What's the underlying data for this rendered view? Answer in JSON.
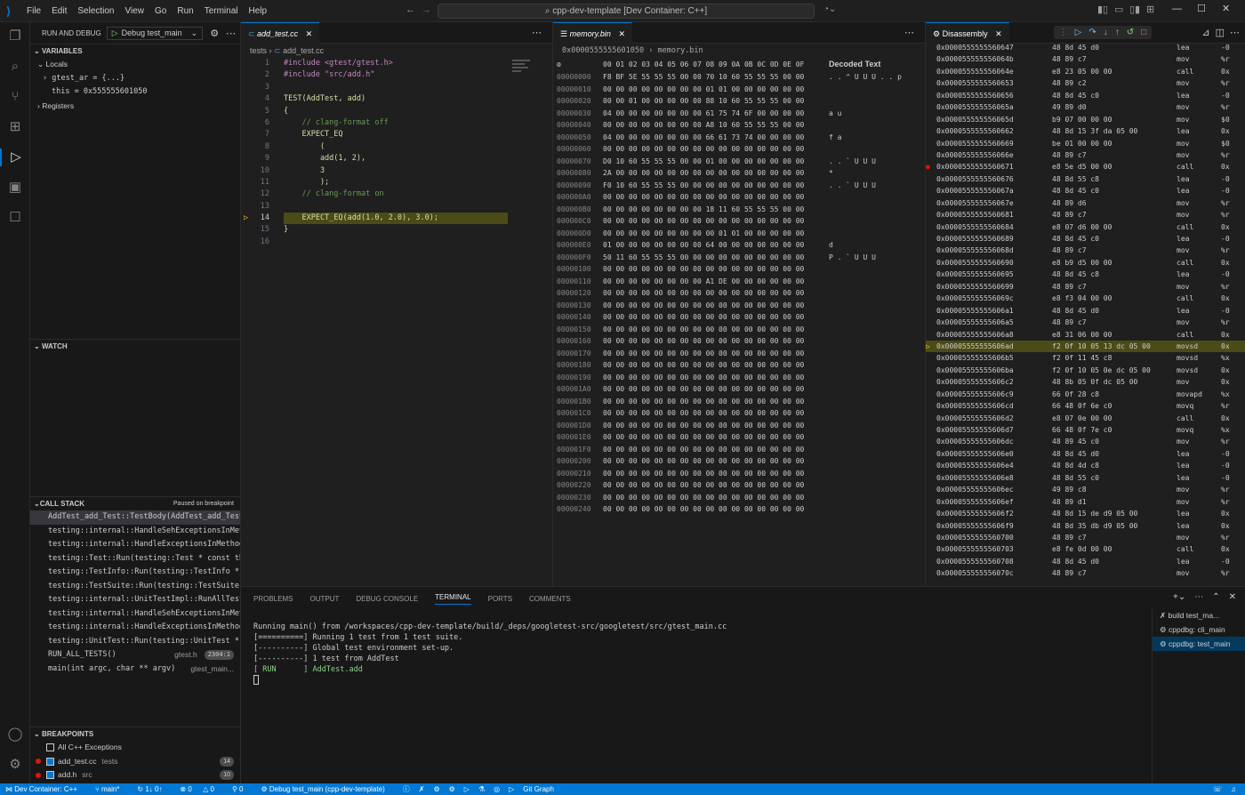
{
  "menu": [
    "File",
    "Edit",
    "Selection",
    "View",
    "Go",
    "Run",
    "Terminal",
    "Help"
  ],
  "command_center": "cpp-dev-template [Dev Container: C++]",
  "sidebar": {
    "title": "RUN AND DEBUG",
    "config": "Debug test_main",
    "variables_header": "VARIABLES",
    "locals": "Locals",
    "vars": [
      "gtest_ar = {...}",
      "this = 0x555555601050"
    ],
    "registers": "Registers",
    "watch_header": "WATCH",
    "callstack_header": "CALL STACK",
    "callstack_status": "Paused on breakpoint",
    "frames": [
      {
        "name": "AddTest_add_Test::TestBody(AddTest_add_Test",
        "file": "",
        "badge": ""
      },
      {
        "name": "testing::internal::HandleSehExceptionsInMet",
        "file": "",
        "badge": ""
      },
      {
        "name": "testing::internal::HandleExceptionsInMethod",
        "file": "",
        "badge": ""
      },
      {
        "name": "testing::Test::Run(testing::Test * const th",
        "file": "",
        "badge": ""
      },
      {
        "name": "testing::TestInfo::Run(testing::TestInfo *",
        "file": "",
        "badge": ""
      },
      {
        "name": "testing::TestSuite::Run(testing::TestSuite",
        "file": "",
        "badge": ""
      },
      {
        "name": "testing::internal::UnitTestImpl::RunAllTest",
        "file": "",
        "badge": ""
      },
      {
        "name": "testing::internal::HandleSehExceptionsInMet",
        "file": "",
        "badge": ""
      },
      {
        "name": "testing::internal::HandleExceptionsInMethod",
        "file": "",
        "badge": ""
      },
      {
        "name": "testing::UnitTest::Run(testing::UnitTest *",
        "file": "",
        "badge": ""
      },
      {
        "name": "RUN_ALL_TESTS()",
        "file": "gtest.h",
        "badge": "2304:1"
      },
      {
        "name": "main(int argc, char ** argv)",
        "file": "gtest_main...",
        "badge": ""
      }
    ],
    "breakpoints_header": "BREAKPOINTS",
    "breakpoints": [
      {
        "label": "All C++ Exceptions",
        "dir": "",
        "count": ""
      },
      {
        "label": "add_test.cc",
        "dir": "tests",
        "count": "14"
      },
      {
        "label": "add.h",
        "dir": "src",
        "count": "10"
      }
    ]
  },
  "editor1": {
    "tab": "add_test.cc",
    "crumb_dir": "tests",
    "crumb_file": "add_test.cc",
    "lines": [
      "#include <gtest/gtest.h>",
      "#include \"src/add.h\"",
      "",
      "TEST(AddTest, add)",
      "{",
      "    // clang-format off",
      "    EXPECT_EQ",
      "        (",
      "        add(1, 2),",
      "        3",
      "        );",
      "    // clang-format on",
      "",
      "    EXPECT_EQ(add(1.0, 2.0), 3.0);",
      "}",
      ""
    ],
    "current_line": 14
  },
  "editor2": {
    "tab": "memory.bin",
    "crumb_addr": "0x0000555555601050",
    "crumb_file": "memory.bin",
    "header": "00 01 02 03 04 05 06 07 08 09 0A 0B 0C 0D 0E 0F",
    "decoded_title": "Decoded Text",
    "rows": [
      {
        "o": "00000000",
        "h": "F8 BF 5E 55 55 55 00 00 70 10 60 55 55 55 00 00",
        "d": ". . ^ U U U . . p"
      },
      {
        "o": "00000010",
        "h": "00 00 00 00 00 00 00 00 01 01 00 00 00 00 00 00",
        "d": ""
      },
      {
        "o": "00000020",
        "h": "00 00 01 00 00 00 00 00 88 10 60 55 55 55 00 00",
        "d": ""
      },
      {
        "o": "00000030",
        "h": "04 00 00 00 00 00 00 00 61 75 74 6F 00 00 00 00",
        "d": "a u"
      },
      {
        "o": "00000040",
        "h": "00 00 00 00 00 00 00 00 A8 10 60 55 55 55 00 00",
        "d": ""
      },
      {
        "o": "00000050",
        "h": "04 00 00 00 00 00 00 00 66 61 73 74 00 00 00 00",
        "d": "f a"
      },
      {
        "o": "00000060",
        "h": "00 00 00 00 00 00 00 00 00 00 00 00 00 00 00 00",
        "d": ""
      },
      {
        "o": "00000070",
        "h": "D0 10 60 55 55 55 00 00 01 00 00 00 00 00 00 00",
        "d": ". . ` U U U"
      },
      {
        "o": "00000080",
        "h": "2A 00 00 00 00 00 00 00 00 00 00 00 00 00 00 00",
        "d": "*"
      },
      {
        "o": "00000090",
        "h": "F0 10 60 55 55 55 00 00 00 00 00 00 00 00 00 00",
        "d": ". . ` U U U"
      },
      {
        "o": "000000A0",
        "h": "00 00 00 00 00 00 00 00 00 00 00 00 00 00 00 00",
        "d": ""
      },
      {
        "o": "000000B0",
        "h": "00 00 00 00 00 00 00 00 18 11 60 55 55 55 00 00",
        "d": ""
      },
      {
        "o": "000000C0",
        "h": "00 00 00 00 00 00 00 00 00 00 00 00 00 00 00 00",
        "d": ""
      },
      {
        "o": "000000D0",
        "h": "00 00 00 00 00 00 00 00 00 01 01 00 00 00 00 00",
        "d": ""
      },
      {
        "o": "000000E0",
        "h": "01 00 00 00 00 00 00 00 64 00 00 00 00 00 00 00",
        "d": "d"
      },
      {
        "o": "000000F0",
        "h": "50 11 60 55 55 55 00 00 00 00 00 00 00 00 00 00",
        "d": "P . ` U U U"
      },
      {
        "o": "00000100",
        "h": "00 00 00 00 00 00 00 00 00 00 00 00 00 00 00 00",
        "d": ""
      },
      {
        "o": "00000110",
        "h": "00 00 00 00 00 00 00 00 A1 DE 00 00 00 00 00 00",
        "d": ""
      },
      {
        "o": "00000120",
        "h": "00 00 00 00 00 00 00 00 00 00 00 00 00 00 00 00",
        "d": ""
      },
      {
        "o": "00000130",
        "h": "00 00 00 00 00 00 00 00 00 00 00 00 00 00 00 00",
        "d": ""
      },
      {
        "o": "00000140",
        "h": "00 00 00 00 00 00 00 00 00 00 00 00 00 00 00 00",
        "d": ""
      },
      {
        "o": "00000150",
        "h": "00 00 00 00 00 00 00 00 00 00 00 00 00 00 00 00",
        "d": ""
      },
      {
        "o": "00000160",
        "h": "00 00 00 00 00 00 00 00 00 00 00 00 00 00 00 00",
        "d": ""
      },
      {
        "o": "00000170",
        "h": "00 00 00 00 00 00 00 00 00 00 00 00 00 00 00 00",
        "d": ""
      },
      {
        "o": "00000180",
        "h": "00 00 00 00 00 00 00 00 00 00 00 00 00 00 00 00",
        "d": ""
      },
      {
        "o": "00000190",
        "h": "00 00 00 00 00 00 00 00 00 00 00 00 00 00 00 00",
        "d": ""
      },
      {
        "o": "000001A0",
        "h": "00 00 00 00 00 00 00 00 00 00 00 00 00 00 00 00",
        "d": ""
      },
      {
        "o": "000001B0",
        "h": "00 00 00 00 00 00 00 00 00 00 00 00 00 00 00 00",
        "d": ""
      },
      {
        "o": "000001C0",
        "h": "00 00 00 00 00 00 00 00 00 00 00 00 00 00 00 00",
        "d": ""
      },
      {
        "o": "000001D0",
        "h": "00 00 00 00 00 00 00 00 00 00 00 00 00 00 00 00",
        "d": ""
      },
      {
        "o": "000001E0",
        "h": "00 00 00 00 00 00 00 00 00 00 00 00 00 00 00 00",
        "d": ""
      },
      {
        "o": "000001F0",
        "h": "00 00 00 00 00 00 00 00 00 00 00 00 00 00 00 00",
        "d": ""
      },
      {
        "o": "00000200",
        "h": "00 00 00 00 00 00 00 00 00 00 00 00 00 00 00 00",
        "d": ""
      },
      {
        "o": "00000210",
        "h": "00 00 00 00 00 00 00 00 00 00 00 00 00 00 00 00",
        "d": ""
      },
      {
        "o": "00000220",
        "h": "00 00 00 00 00 00 00 00 00 00 00 00 00 00 00 00",
        "d": ""
      },
      {
        "o": "00000230",
        "h": "00 00 00 00 00 00 00 00 00 00 00 00 00 00 00 00",
        "d": ""
      },
      {
        "o": "00000240",
        "h": "00 00 00 00 00 00 00 00 00 00 00 00 00 00 00 00",
        "d": ""
      }
    ]
  },
  "editor3": {
    "tab": "Disassembly",
    "rows": [
      {
        "a": "0x0000555555560647",
        "b": "48 8d 45 d0",
        "m": "lea",
        "o": "-0"
      },
      {
        "a": "0x000055555556064b",
        "b": "48 89 c7",
        "m": "mov",
        "o": "%r"
      },
      {
        "a": "0x000055555556064e",
        "b": "e8 23 05 00 00",
        "m": "call",
        "o": "0x"
      },
      {
        "a": "0x0000555555560653",
        "b": "48 89 c2",
        "m": "mov",
        "o": "%r"
      },
      {
        "a": "0x0000555555560656",
        "b": "48 8d 45 c0",
        "m": "lea",
        "o": "-0"
      },
      {
        "a": "0x000055555556065a",
        "b": "49 89 d0",
        "m": "mov",
        "o": "%r"
      },
      {
        "a": "0x000055555556065d",
        "b": "b9 07 00 00 00",
        "m": "mov",
        "o": "$0"
      },
      {
        "a": "0x0000555555560662",
        "b": "48 8d 15 3f da 05 00",
        "m": "lea",
        "o": "0x"
      },
      {
        "a": "0x0000555555560669",
        "b": "be 01 00 00 00",
        "m": "mov",
        "o": "$0"
      },
      {
        "a": "0x000055555556066e",
        "b": "48 89 c7",
        "m": "mov",
        "o": "%r"
      },
      {
        "a": "0x0000555555560671",
        "b": "e8 5e d5 00 00",
        "m": "call",
        "o": "0x"
      },
      {
        "a": "0x0000555555560676",
        "b": "48 8d 55 c8",
        "m": "lea",
        "o": "-0"
      },
      {
        "a": "0x000055555556067a",
        "b": "48 8d 45 c0",
        "m": "lea",
        "o": "-0"
      },
      {
        "a": "0x000055555556067e",
        "b": "48 89 d6",
        "m": "mov",
        "o": "%r"
      },
      {
        "a": "0x0000555555560681",
        "b": "48 89 c7",
        "m": "mov",
        "o": "%r"
      },
      {
        "a": "0x0000555555560684",
        "b": "e8 07 d6 00 00",
        "m": "call",
        "o": "0x"
      },
      {
        "a": "0x0000555555560689",
        "b": "48 8d 45 c0",
        "m": "lea",
        "o": "-0"
      },
      {
        "a": "0x000055555556068d",
        "b": "48 89 c7",
        "m": "mov",
        "o": "%r"
      },
      {
        "a": "0x0000555555560690",
        "b": "e8 b9 d5 00 00",
        "m": "call",
        "o": "0x"
      },
      {
        "a": "0x0000555555560695",
        "b": "48 8d 45 c8",
        "m": "lea",
        "o": "-0"
      },
      {
        "a": "0x0000555555560699",
        "b": "48 89 c7",
        "m": "mov",
        "o": "%r"
      },
      {
        "a": "0x000055555556069c",
        "b": "e8 f3 04 00 00",
        "m": "call",
        "o": "0x"
      },
      {
        "a": "0x00005555555606a1",
        "b": "48 8d 45 d0",
        "m": "lea",
        "o": "-0"
      },
      {
        "a": "0x00005555555606a5",
        "b": "48 89 c7",
        "m": "mov",
        "o": "%r"
      },
      {
        "a": "0x00005555555606a8",
        "b": "e8 31 06 00 00",
        "m": "call",
        "o": "0x"
      },
      {
        "a": "0x00005555555606ad",
        "b": "f2 0f 10 05 13 dc 05 00",
        "m": "movsd",
        "o": "0x"
      },
      {
        "a": "0x00005555555606b5",
        "b": "f2 0f 11 45 c8",
        "m": "movsd",
        "o": "%x"
      },
      {
        "a": "0x00005555555606ba",
        "b": "f2 0f 10 05 0e dc 05 00",
        "m": "movsd",
        "o": "0x"
      },
      {
        "a": "0x00005555555606c2",
        "b": "48 8b 05 0f dc 05 00",
        "m": "mov",
        "o": "0x"
      },
      {
        "a": "0x00005555555606c9",
        "b": "66 0f 28 c8",
        "m": "movapd",
        "o": "%x"
      },
      {
        "a": "0x00005555555606cd",
        "b": "66 48 0f 6e c0",
        "m": "movq",
        "o": "%r"
      },
      {
        "a": "0x00005555555606d2",
        "b": "e8 07 0e 00 00",
        "m": "call",
        "o": "0x"
      },
      {
        "a": "0x00005555555606d7",
        "b": "66 48 0f 7e c0",
        "m": "movq",
        "o": "%x"
      },
      {
        "a": "0x00005555555606dc",
        "b": "48 89 45 c0",
        "m": "mov",
        "o": "%r"
      },
      {
        "a": "0x00005555555606e0",
        "b": "48 8d 45 d0",
        "m": "lea",
        "o": "-0"
      },
      {
        "a": "0x00005555555606e4",
        "b": "48 8d 4d c8",
        "m": "lea",
        "o": "-0"
      },
      {
        "a": "0x00005555555606e8",
        "b": "48 8d 55 c0",
        "m": "lea",
        "o": "-0"
      },
      {
        "a": "0x00005555555606ec",
        "b": "49 89 c8",
        "m": "mov",
        "o": "%r"
      },
      {
        "a": "0x00005555555606ef",
        "b": "48 89 d1",
        "m": "mov",
        "o": "%r"
      },
      {
        "a": "0x00005555555606f2",
        "b": "48 8d 15 de d9 05 00",
        "m": "lea",
        "o": "0x"
      },
      {
        "a": "0x00005555555606f9",
        "b": "48 8d 35 db d9 05 00",
        "m": "lea",
        "o": "0x"
      },
      {
        "a": "0x0000555555560700",
        "b": "48 89 c7",
        "m": "mov",
        "o": "%r"
      },
      {
        "a": "0x0000555555560703",
        "b": "e8 fe 0d 00 00",
        "m": "call",
        "o": "0x"
      },
      {
        "a": "0x0000555555560708",
        "b": "48 8d 45 d0",
        "m": "lea",
        "o": "-0"
      },
      {
        "a": "0x000055555556070c",
        "b": "48 89 c7",
        "m": "mov",
        "o": "%r"
      }
    ],
    "current_index": 25,
    "breakpoint_index": 10
  },
  "panel": {
    "tabs": [
      "PROBLEMS",
      "OUTPUT",
      "DEBUG CONSOLE",
      "TERMINAL",
      "PORTS",
      "COMMENTS"
    ],
    "active_tab": "TERMINAL",
    "lines": [
      "Running main() from /workspaces/cpp-dev-template/build/_deps/googletest-src/googletest/src/gtest_main.cc",
      "[==========] Running 1 test from 1 test suite.",
      "[----------] Global test environment set-up.",
      "[----------] 1 test from AddTest",
      "[ RUN      ] AddTest.add"
    ],
    "terminals": [
      "build test_ma...",
      "cppdbg: cli_main",
      "cppdbg: test_main"
    ]
  },
  "status": {
    "remote": "Dev Container: C++",
    "branch": "main*",
    "sync": "1↓ 0↑",
    "errors": "0",
    "warnings": "0",
    "ports": "0",
    "debug": "Debug test_main (cpp-dev-template)",
    "git_graph": "Git Graph"
  },
  "colors": {
    "accent": "#0078d4",
    "highlight": "#4b4b18",
    "breakpoint": "#e51400"
  }
}
